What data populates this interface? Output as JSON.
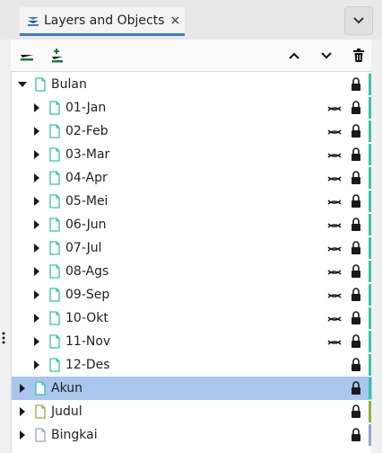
{
  "tab": {
    "title": "Layers and Objects",
    "close_glyph": "×",
    "icon": "layers-icon"
  },
  "toolbar": {
    "buttons": [
      "add-layer-icon",
      "add-sublayer-icon",
      "move-up-icon",
      "move-down-icon",
      "trash-icon"
    ]
  },
  "colors": {
    "accent_tab": "#3a78d6",
    "teal": "#36c3a6",
    "olive": "#93b03a",
    "blue": "#8ea6d6",
    "selected_row": "#a8c6ee",
    "icon_dark": "#1a1a1a"
  },
  "layers": {
    "root": {
      "label": "Bulan",
      "expanded": true,
      "hidden_toggle": false,
      "locked": true,
      "color": "#36c3a6"
    },
    "children": [
      {
        "label": "01-Jan"
      },
      {
        "label": "02-Feb"
      },
      {
        "label": "03-Mar"
      },
      {
        "label": "04-Apr"
      },
      {
        "label": "05-Mei"
      },
      {
        "label": "06-Jun"
      },
      {
        "label": "07-Jul"
      },
      {
        "label": "08-Ags"
      },
      {
        "label": "09-Sep"
      },
      {
        "label": "10-Okt"
      },
      {
        "label": "11-Nov"
      },
      {
        "label": "12-Des"
      }
    ],
    "others": [
      {
        "label": "Akun",
        "color": "#36c3a6",
        "selected": true
      },
      {
        "label": "Judul",
        "color": "#93b03a"
      },
      {
        "label": "Bingkai",
        "color": "#8ea6d6"
      }
    ]
  }
}
